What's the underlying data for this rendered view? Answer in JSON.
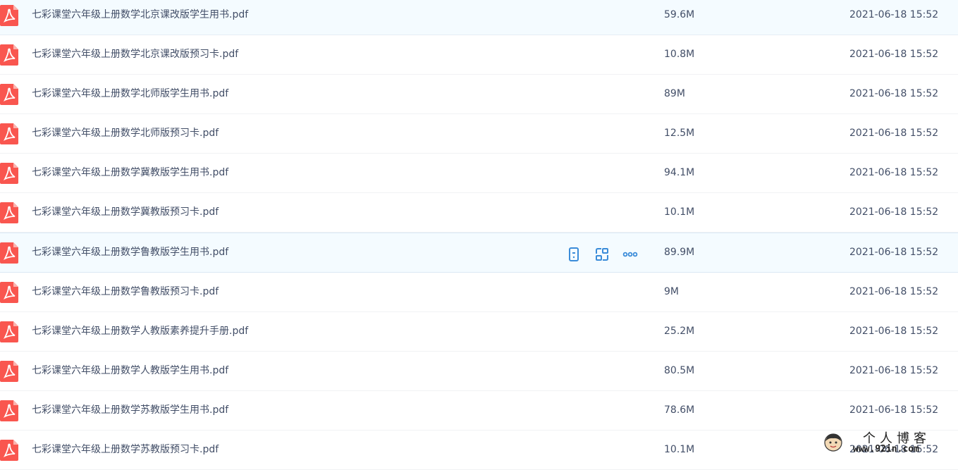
{
  "files": [
    {
      "name": "七彩课堂六年级上册数学北京课改版学生用书.pdf",
      "size": "59.6M",
      "time": "2021-06-18 15:52"
    },
    {
      "name": "七彩课堂六年级上册数学北京课改版预习卡.pdf",
      "size": "10.8M",
      "time": "2021-06-18 15:52"
    },
    {
      "name": "七彩课堂六年级上册数学北师版学生用书.pdf",
      "size": "89M",
      "time": "2021-06-18 15:52"
    },
    {
      "name": "七彩课堂六年级上册数学北师版预习卡.pdf",
      "size": "12.5M",
      "time": "2021-06-18 15:52"
    },
    {
      "name": "七彩课堂六年级上册数学冀教版学生用书.pdf",
      "size": "94.1M",
      "time": "2021-06-18 15:52"
    },
    {
      "name": "七彩课堂六年级上册数学冀教版预习卡.pdf",
      "size": "10.1M",
      "time": "2021-06-18 15:52"
    },
    {
      "name": "七彩课堂六年级上册数学鲁教版学生用书.pdf",
      "size": "89.9M",
      "time": "2021-06-18 15:52"
    },
    {
      "name": "七彩课堂六年级上册数学鲁教版预习卡.pdf",
      "size": "9M",
      "time": "2021-06-18 15:52"
    },
    {
      "name": "七彩课堂六年级上册数学人教版素养提升手册.pdf",
      "size": "25.2M",
      "time": "2021-06-18 15:52"
    },
    {
      "name": "七彩课堂六年级上册数学人教版学生用书.pdf",
      "size": "80.5M",
      "time": "2021-06-18 15:52"
    },
    {
      "name": "七彩课堂六年级上册数学苏教版学生用书.pdf",
      "size": "78.6M",
      "time": "2021-06-18 15:52"
    },
    {
      "name": "七彩课堂六年级上册数学苏教版预习卡.pdf",
      "size": "10.1M",
      "time": "2021-06-18 15:52"
    }
  ],
  "hovered_row": 6,
  "row_actions": [
    {
      "icon": "phone-icon"
    },
    {
      "icon": "share-link-icon"
    },
    {
      "icon": "more-icon"
    }
  ],
  "watermark": {
    "title": "个人博客",
    "url": "www.92in.com"
  },
  "colors": {
    "pdf_icon": "#f9564f",
    "action_icon": "#3b8cd9",
    "hover_bg": "#f4fbff",
    "text": "#424e67"
  }
}
